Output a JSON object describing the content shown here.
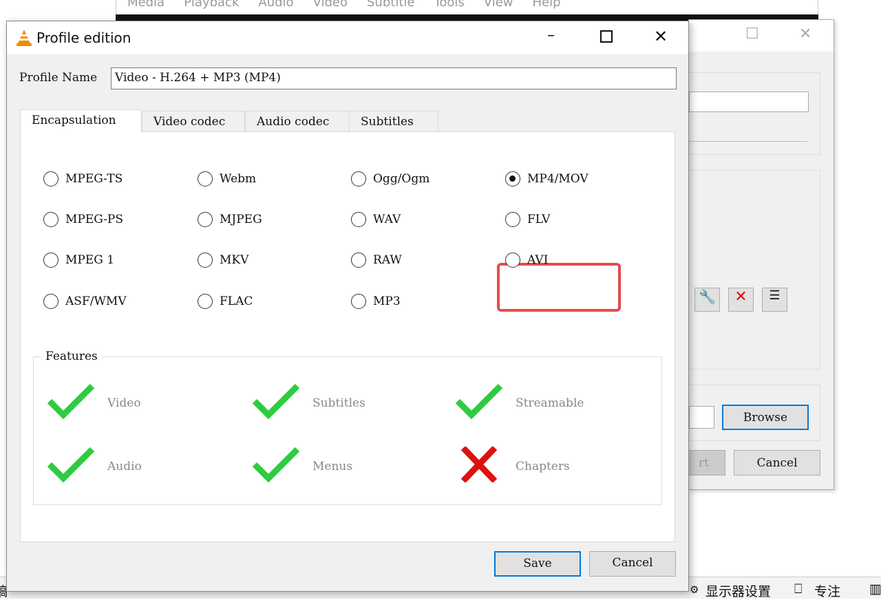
{
  "background": {
    "menu": [
      "Media",
      "Playback",
      "Audio",
      "Video",
      "Subtitle",
      "Tools",
      "View",
      "Help"
    ],
    "convert_dialog": {
      "browse": "Browse",
      "start_partial": "rt",
      "cancel": "Cancel"
    },
    "taskbar": {
      "partial_left": "稿",
      "display_settings": "显示器设置",
      "focus": "专注"
    }
  },
  "dialog": {
    "title": "Profile edition",
    "profile_name_label": "Profile Name",
    "profile_name_value": "Video - H.264 + MP3 (MP4)",
    "tabs": [
      "Encapsulation",
      "Video codec",
      "Audio codec",
      "Subtitles"
    ],
    "active_tab": "Encapsulation",
    "formats": [
      [
        "MPEG-TS",
        "Webm",
        "Ogg/Ogm",
        "MP4/MOV"
      ],
      [
        "MPEG-PS",
        "MJPEG",
        "WAV",
        "FLV"
      ],
      [
        "MPEG 1",
        "MKV",
        "RAW",
        "AVI"
      ],
      [
        "ASF/WMV",
        "FLAC",
        "MP3"
      ]
    ],
    "selected": "MP4/MOV",
    "features_label": "Features",
    "features": [
      {
        "label": "Video",
        "ok": true
      },
      {
        "label": "Subtitles",
        "ok": true
      },
      {
        "label": "Streamable",
        "ok": true
      },
      {
        "label": "Audio",
        "ok": true
      },
      {
        "label": "Menus",
        "ok": true
      },
      {
        "label": "Chapters",
        "ok": false
      }
    ],
    "save": "Save",
    "cancel": "Cancel"
  },
  "colors": {
    "check": "#2ecc40",
    "cross": "#dd1111",
    "highlight": "#e84a4a"
  }
}
